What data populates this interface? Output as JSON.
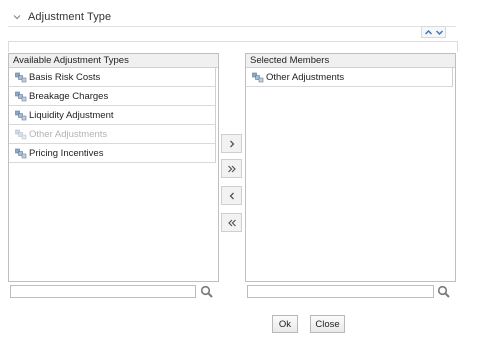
{
  "section": {
    "title": "Adjustment Type",
    "expanded": true
  },
  "available": {
    "header": "Available Adjustment Types",
    "items": [
      {
        "label": "Basis Risk Costs",
        "disabled": false
      },
      {
        "label": "Breakage Charges",
        "disabled": false
      },
      {
        "label": "Liquidity Adjustment",
        "disabled": false
      },
      {
        "label": "Other Adjustments",
        "disabled": true
      },
      {
        "label": "Pricing Incentives",
        "disabled": false
      }
    ],
    "search_value": ""
  },
  "selected": {
    "header": "Selected Members",
    "items": [
      {
        "label": "Other Adjustments",
        "disabled": false
      }
    ],
    "search_value": ""
  },
  "move_buttons": {
    "move_right": "›",
    "move_all_right": "»",
    "move_left": "‹",
    "move_all_left": "«"
  },
  "footer": {
    "ok_label": "Ok",
    "close_label": "Close"
  },
  "icons": {
    "section_toggle": "chevron-down-icon",
    "expand_collapse": [
      "chevron-up-icon",
      "chevron-down-icon"
    ],
    "member": "member-icon",
    "search": "search-icon"
  },
  "colors": {
    "accent": "#3a78c2",
    "disabled_text": "#b3b3b3",
    "border": "#bfbfbf"
  }
}
